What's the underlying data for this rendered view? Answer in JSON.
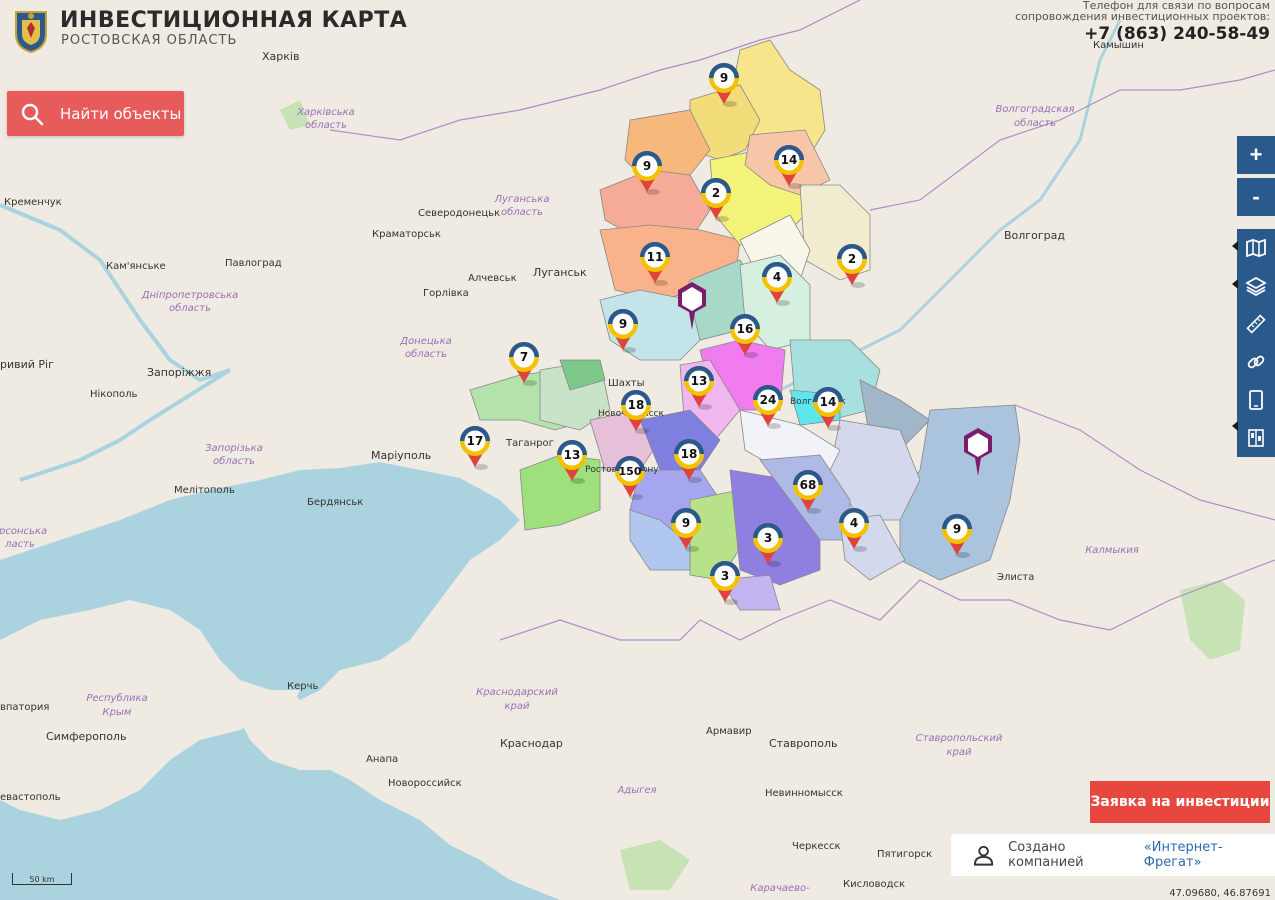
{
  "header": {
    "title": "ИНВЕСТИЦИОННАЯ КАРТА",
    "subtitle": "РОСТОВСКАЯ ОБЛАСТЬ",
    "contact_line1": "Телефон для связи по вопросам",
    "contact_line2": "сопровождения инвестиционных проектов:",
    "phone": "+7 (863) 240-58-49"
  },
  "search_button": {
    "label": "Найти объекты",
    "icon": "search-icon"
  },
  "toolbar": {
    "zoom_in": "+",
    "zoom_out": "-",
    "items": [
      {
        "name": "map-layers-icon"
      },
      {
        "name": "layers-stack-icon"
      },
      {
        "name": "ruler-icon"
      },
      {
        "name": "link-icon"
      },
      {
        "name": "tablet-icon"
      },
      {
        "name": "legend-icon"
      }
    ]
  },
  "apply_button": {
    "label": "Заявка на инвестиции"
  },
  "credits": {
    "text": "Создано компанией",
    "link": "«Интернет-Фрегат»"
  },
  "coordinates": "47.09680, 46.87691",
  "scale_label": "50 km",
  "map_labels": {
    "cities": [
      {
        "id": "kharkiv",
        "text": "Харків"
      },
      {
        "id": "kamyshin",
        "text": "Камышин"
      },
      {
        "id": "kremenchuk",
        "text": "Кременчук"
      },
      {
        "id": "severodonetsk",
        "text": "Северодонецьк"
      },
      {
        "id": "kramatorsk",
        "text": "Краматорськ"
      },
      {
        "id": "kamianske",
        "text": "Кам'янське"
      },
      {
        "id": "pavlohrad",
        "text": "Павлоград"
      },
      {
        "id": "alchevsk",
        "text": "Алчевськ"
      },
      {
        "id": "luhansk",
        "text": "Луганськ"
      },
      {
        "id": "horlivka",
        "text": "Горлівка"
      },
      {
        "id": "volgograd",
        "text": "Волгоград"
      },
      {
        "id": "kryvyi_rih",
        "text": "ривий Ріг"
      },
      {
        "id": "zaporizhzhia",
        "text": "Запоріжжя"
      },
      {
        "id": "nikopol",
        "text": "Нікополь"
      },
      {
        "id": "mariupol",
        "text": "Маріуполь"
      },
      {
        "id": "melitopol",
        "text": "Мелітополь"
      },
      {
        "id": "berdiansk",
        "text": "Бердянськ"
      },
      {
        "id": "taganrog",
        "text": "Таганрог"
      },
      {
        "id": "shakhty",
        "text": "Шахты"
      },
      {
        "id": "novocherkassk",
        "text": "Новочеркасск"
      },
      {
        "id": "rostov",
        "text": "Ростов-на-Дону"
      },
      {
        "id": "volgodonsk",
        "text": "Волгодонск"
      },
      {
        "id": "elista",
        "text": "Элиста"
      },
      {
        "id": "kerch",
        "text": "Керчь"
      },
      {
        "id": "simferopol",
        "text": "Симферополь"
      },
      {
        "id": "anapa",
        "text": "Анапа"
      },
      {
        "id": "novorossiysk",
        "text": "Новороссийск"
      },
      {
        "id": "krasnodar",
        "text": "Краснодар"
      },
      {
        "id": "armavir",
        "text": "Армавир"
      },
      {
        "id": "stavropol",
        "text": "Ставрополь"
      },
      {
        "id": "nevinnomyssk",
        "text": "Невинномысск"
      },
      {
        "id": "cherkessk",
        "text": "Черкесск"
      },
      {
        "id": "pyatigorsk",
        "text": "Пятигорск"
      },
      {
        "id": "kislovodsk",
        "text": "Кисловодск"
      },
      {
        "id": "evastopol",
        "text": "евастополь"
      },
      {
        "id": "epatoriya",
        "text": "впатория"
      }
    ],
    "regions": [
      {
        "id": "kharkivska",
        "line1": "Харківська",
        "line2": "область"
      },
      {
        "id": "luhanska",
        "line1": "Луганська",
        "line2": "область"
      },
      {
        "id": "volgogradskaya",
        "line1": "Волгоградская",
        "line2": "область"
      },
      {
        "id": "dnipro",
        "line1": "Дніпропетровська",
        "line2": "область"
      },
      {
        "id": "donetska",
        "line1": "Донецька",
        "line2": "область"
      },
      {
        "id": "zaporizka",
        "line1": "Запорізька",
        "line2": "область"
      },
      {
        "id": "khersonska",
        "line1": "ерсонська",
        "line2": "ласть"
      },
      {
        "id": "kalmykiya",
        "line1": "Калмыкия",
        "line2": ""
      },
      {
        "id": "krasnodarsky",
        "line1": "Краснодарский",
        "line2": "край"
      },
      {
        "id": "stavropolsky",
        "line1": "Ставропольский",
        "line2": "край"
      },
      {
        "id": "krym",
        "line1": "Республика",
        "line2": "Крым"
      },
      {
        "id": "adygea",
        "line1": "Адыгея",
        "line2": ""
      },
      {
        "id": "karachaevo",
        "line1": "Карачаево-",
        "line2": ""
      }
    ]
  },
  "markers": [
    {
      "value": "9"
    },
    {
      "value": "14"
    },
    {
      "value": "9"
    },
    {
      "value": "2"
    },
    {
      "value": "11"
    },
    {
      "value": "4"
    },
    {
      "value": "2"
    },
    {
      "value": "9"
    },
    {
      "value": "16"
    },
    {
      "value": "7"
    },
    {
      "value": "13"
    },
    {
      "value": "18"
    },
    {
      "value": "24"
    },
    {
      "value": "14"
    },
    {
      "value": "17"
    },
    {
      "value": "13"
    },
    {
      "value": "18"
    },
    {
      "value": "150"
    },
    {
      "value": "68"
    },
    {
      "value": "9"
    },
    {
      "value": "4"
    },
    {
      "value": "3"
    },
    {
      "value": "9"
    },
    {
      "value": "3"
    }
  ],
  "colors": {
    "accent_red": "#e85b5b",
    "apply_red": "#e8473f",
    "toolbar_blue": "#2a5a8c",
    "marker_blue": "#2a5a8c",
    "marker_yellow": "#f2c200",
    "marker_red": "#e0433b",
    "poi_purple": "#7b1d6d"
  }
}
